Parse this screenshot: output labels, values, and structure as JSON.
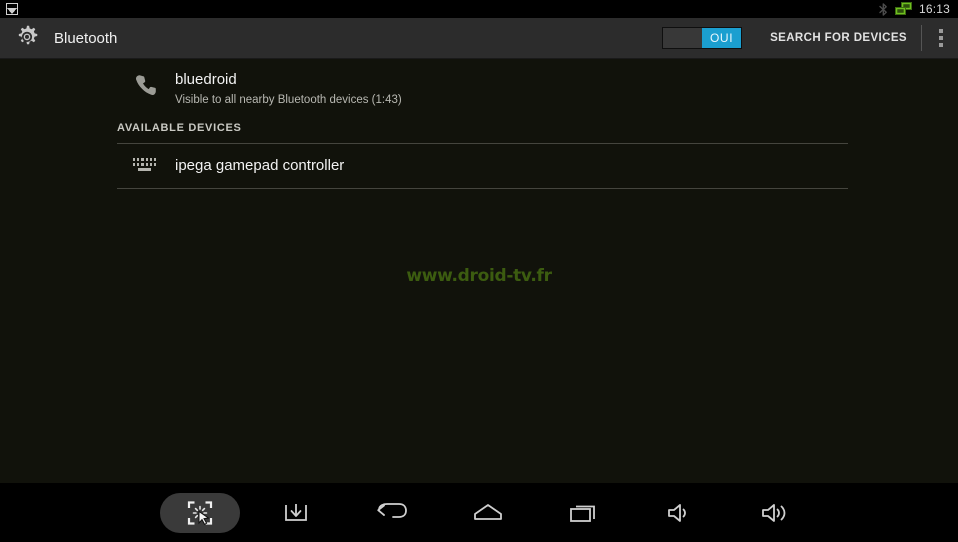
{
  "status_bar": {
    "notification_icon": "screenshot-image-icon",
    "icons": [
      "bluetooth-icon",
      "ethernet-icon"
    ],
    "clock": "16:13"
  },
  "action_bar": {
    "app_icon": "settings-gear-icon",
    "title": "Bluetooth",
    "toggle": {
      "on_label": "OUI",
      "state": "on",
      "accent_color": "#1b9fd0"
    },
    "search_label": "SEARCH FOR DEVICES",
    "overflow_icon": "overflow-menu-icon"
  },
  "content": {
    "local_device": {
      "icon": "phone-icon",
      "name": "bluedroid",
      "status": "Visible to all nearby Bluetooth devices (1:43)"
    },
    "section_header": "AVAILABLE DEVICES",
    "available_devices": [
      {
        "icon": "keyboard-icon",
        "name": "ipega gamepad controller"
      }
    ]
  },
  "watermark": {
    "text": "www.droid-tv.fr",
    "color": "#3f6111"
  },
  "nav_bar": {
    "buttons": [
      {
        "name": "screenshot",
        "icon": "screenshot-capture-icon",
        "active": true
      },
      {
        "name": "download",
        "icon": "download-icon",
        "active": false
      },
      {
        "name": "back",
        "icon": "back-arrow-icon",
        "active": false
      },
      {
        "name": "home",
        "icon": "home-icon",
        "active": false
      },
      {
        "name": "recents",
        "icon": "recents-icon",
        "active": false
      },
      {
        "name": "volume-down",
        "icon": "volume-down-icon",
        "active": false
      },
      {
        "name": "volume-up",
        "icon": "volume-up-icon",
        "active": false
      }
    ]
  }
}
